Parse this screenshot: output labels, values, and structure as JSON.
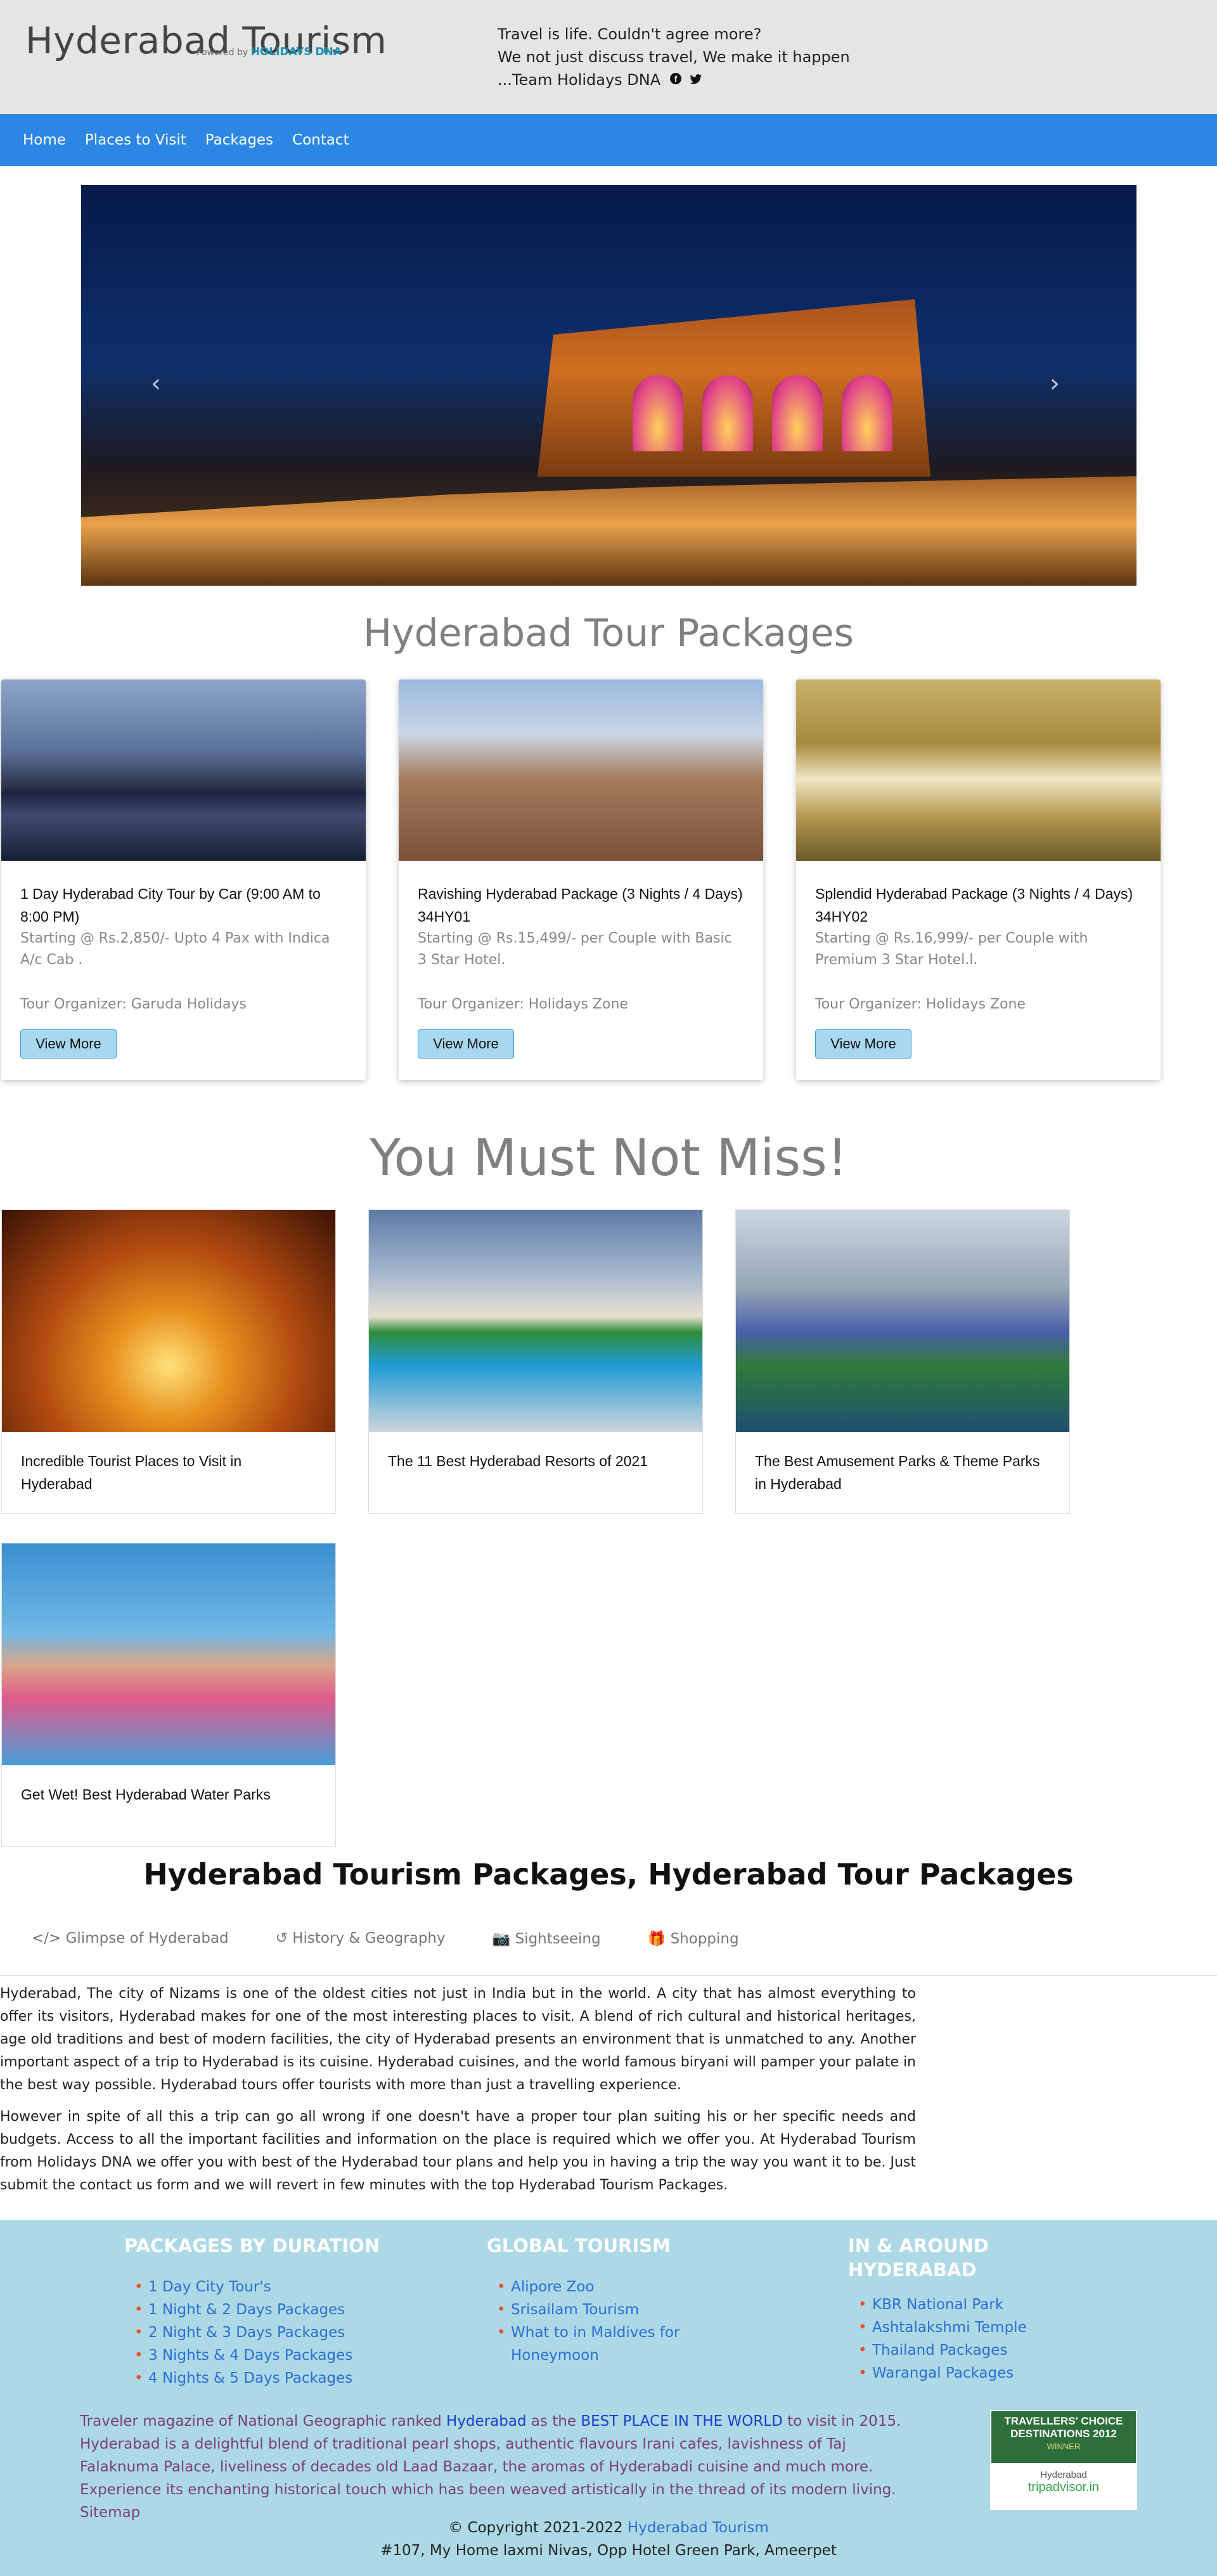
{
  "header": {
    "title": "Hyderabad Tourism",
    "powered_prefix": "Powered by",
    "powered_brand": "HOLIDAYS DNA",
    "tagline_1": "Travel is life. Couldn't agree more?",
    "tagline_2": "We not just discuss travel, We make it happen",
    "tagline_3": "...Team Holidays DNA",
    "social_icons": [
      "facebook-icon",
      "twitter-icon"
    ]
  },
  "nav": [
    "Home",
    "Places to Visit",
    "Packages",
    "Contact"
  ],
  "carousel": {
    "prev": "‹",
    "next": "›"
  },
  "tour_packages": {
    "title": "Hyderabad Tour Packages",
    "cards": [
      {
        "name": "1 Day Hyderabad City Tour by Car (9:00 AM to 8:00 PM)",
        "price": "Starting @ Rs.2,850/- Upto 4 Pax with Indica A/c Cab .",
        "organizer": "Tour Organizer: Garuda Holidays",
        "button": "View More"
      },
      {
        "name": "Ravishing Hyderabad Package (3 Nights / 4 Days) 34HY01",
        "price": "Starting @ Rs.15,499/- per Couple with Basic 3 Star Hotel.",
        "organizer": "Tour Organizer: Holidays Zone",
        "button": "View More"
      },
      {
        "name": "Splendid Hyderabad Package (3 Nights / 4 Days) 34HY02",
        "price": "Starting @ Rs.16,999/- per Couple with Premium 3 Star Hotel.l.",
        "organizer": "Tour Organizer: Holidays Zone",
        "button": "View More"
      }
    ]
  },
  "must_not_miss": {
    "title": "You Must Not Miss!",
    "cards": [
      "Incredible Tourist Places to Visit in Hyderabad",
      "The 11 Best Hyderabad Resorts of 2021",
      "The Best Amusement Parks & Theme Parks in Hyderabad",
      "Get Wet! Best Hyderabad Water Parks"
    ]
  },
  "packages_section": {
    "title": "Hyderabad Tourism Packages, Hyderabad Tour Packages",
    "tabs": [
      "Glimpse of Hyderabad",
      "History & Geography",
      "Sightseeing",
      "Shopping"
    ],
    "para_1": "Hyderabad, The city of Nizams is one of the oldest cities not just in India but in the world. A city that has almost everything to offer its visitors, Hyderabad makes for one of the most interesting places to visit. A blend of rich cultural and historical heritages, age old traditions and best of modern facilities, the city of Hyderabad presents an environment that is unmatched to any. Another important aspect of a trip to Hyderabad is its cuisine. Hyderabad cuisines, and the world famous biryani will pamper your palate in the best way possible. Hyderabad tours offer tourists with more than just a travelling experience.",
    "para_2": "However in spite of all this a trip can go all wrong if one doesn't have a proper tour plan suiting his or her specific needs and budgets. Access to all the important facilities and information on the place is required which we offer you. At Hyderabad Tourism from Holidays DNA we offer you with best of the Hyderabad tour plans and help you in having a trip the way you want it to be. Just submit the contact us form and we will revert in few minutes with the top Hyderabad Tourism Packages."
  },
  "footer": {
    "col1": {
      "title": "PACKAGES BY DURATION",
      "items": [
        "1 Day City Tour's",
        "1 Night & 2 Days Packages",
        "2 Night & 3 Days Packages",
        "3 Nights & 4 Days Packages",
        "4 Nights & 5 Days Packages"
      ]
    },
    "col2": {
      "title": "GLOBAL TOURISM",
      "items": [
        "Alipore Zoo",
        "Srisailam Tourism",
        "What to in Maldives for Honeymoon"
      ]
    },
    "col3": {
      "title": "IN & AROUND HYDERABAD",
      "items": [
        "KBR National Park",
        "Ashtalakshmi Temple",
        "Thailand Packages",
        "Warangal Packages"
      ]
    },
    "text_1": "Traveler magazine of National Geographic ranked ",
    "link_1": "Hyderabad",
    "text_2": " as the ",
    "link_2": "BEST PLACE IN THE WORLD",
    "text_3": " to visit in 2015. Hyderabad is a delightful blend of traditional pearl shops, authentic flavours Irani cafes, lavishness of Taj Falaknuma Palace, liveliness of decades old Laad Bazaar, the aromas of Hyderabadi cuisine and much more. Experience its enchanting historical touch which has been weaved artistically in the thread of its modern living. Sitemap",
    "award": {
      "line1": "TRAVELLERS' CHOICE",
      "line2": "DESTINATIONS 2012",
      "winner": "WINNER",
      "city": "Hyderabad",
      "brand": "tripadvisor.in"
    },
    "copyright_text": "© Copyright 2021-2022 ",
    "copyright_link": "Hyderabad Tourism",
    "address": "#107, My Home laxmi Nivas, Opp Hotel Green Park, Ameerpet"
  }
}
